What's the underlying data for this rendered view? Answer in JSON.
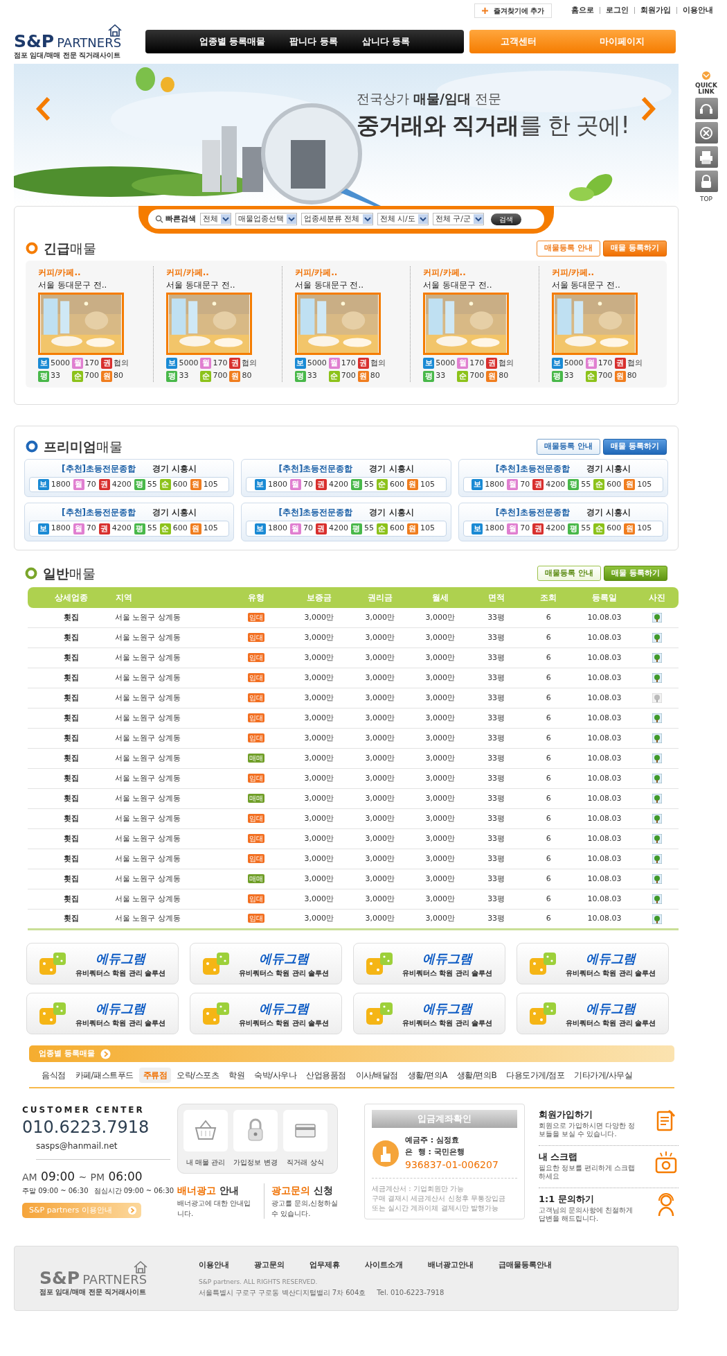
{
  "top_links": {
    "bookmark": "즐겨찾기에 추가",
    "links": [
      "홈으로",
      "로그인",
      "회원가입",
      "이용안내"
    ]
  },
  "logo": {
    "brand": "S&P",
    "brand2": "PARTNERS",
    "tagline": "점포 임대/매매 전문 직거래사이트"
  },
  "nav": {
    "main": [
      "업종별 등록매물",
      "팝니다 등록",
      "삽니다 등록"
    ],
    "side": [
      "고객센터",
      "마이페이지"
    ]
  },
  "banner": {
    "line1": "전국상가 **매물/임대** 전문",
    "line2": "**중거래와 직거래**를 한 곳에!"
  },
  "quick_link": {
    "title": "QUICK LINK",
    "top": "TOP"
  },
  "search": {
    "label": "빠른검색",
    "selects": [
      "전체",
      "매물업종선택",
      "업종세분류 전체",
      "전체 시/도",
      "전체 구/군"
    ],
    "button": "검색"
  },
  "urgent": {
    "title": "**긴급**매물",
    "buttons": [
      "매물등록 안내",
      "매물 등록하기"
    ],
    "items": [
      {
        "category": "커피/카페..",
        "location": "서울 동대문구 전..",
        "kind": "picture",
        "stats": [
          {
            "label": "보",
            "value": "5000",
            "color": "#1a8ad4"
          },
          {
            "label": "월",
            "value": "170",
            "color": "#e07fd0"
          },
          {
            "label": "권",
            "value": "협의",
            "color": "#d8302e"
          },
          {
            "label": "평",
            "value": "33",
            "color": "#49b84a"
          },
          {
            "label": "순",
            "value": "700",
            "color": "#8cc21a"
          },
          {
            "label": "원",
            "value": "80",
            "color": "#f07d1e"
          }
        ]
      },
      {
        "category": "커피/카페..",
        "location": "서울 동대문구 전..",
        "kind": "picture",
        "stats": [
          {
            "label": "보",
            "value": "5000",
            "color": "#1a8ad4"
          },
          {
            "label": "월",
            "value": "170",
            "color": "#e07fd0"
          },
          {
            "label": "권",
            "value": "협의",
            "color": "#d8302e"
          },
          {
            "label": "평",
            "value": "33",
            "color": "#49b84a"
          },
          {
            "label": "순",
            "value": "700",
            "color": "#8cc21a"
          },
          {
            "label": "원",
            "value": "80",
            "color": "#f07d1e"
          }
        ]
      },
      {
        "category": "커피/카페..",
        "location": "서울 동대문구 전..",
        "kind": "picture",
        "stats": [
          {
            "label": "보",
            "value": "5000",
            "color": "#1a8ad4"
          },
          {
            "label": "월",
            "value": "170",
            "color": "#e07fd0"
          },
          {
            "label": "권",
            "value": "협의",
            "color": "#d8302e"
          },
          {
            "label": "평",
            "value": "33",
            "color": "#49b84a"
          },
          {
            "label": "순",
            "value": "700",
            "color": "#8cc21a"
          },
          {
            "label": "원",
            "value": "80",
            "color": "#f07d1e"
          }
        ]
      },
      {
        "category": "커피/카페..",
        "location": "서울 동대문구 전..",
        "kind": "picture",
        "stats": [
          {
            "label": "보",
            "value": "5000",
            "color": "#1a8ad4"
          },
          {
            "label": "월",
            "value": "170",
            "color": "#e07fd0"
          },
          {
            "label": "권",
            "value": "협의",
            "color": "#d8302e"
          },
          {
            "label": "평",
            "value": "33",
            "color": "#49b84a"
          },
          {
            "label": "순",
            "value": "700",
            "color": "#8cc21a"
          },
          {
            "label": "원",
            "value": "80",
            "color": "#f07d1e"
          }
        ]
      },
      {
        "category": "커피/카페..",
        "location": "서울 동대문구 전..",
        "kind": "picture",
        "stats": [
          {
            "label": "보",
            "value": "5000",
            "color": "#1a8ad4"
          },
          {
            "label": "월",
            "value": "170",
            "color": "#e07fd0"
          },
          {
            "label": "권",
            "value": "협의",
            "color": "#d8302e"
          },
          {
            "label": "평",
            "value": "33",
            "color": "#49b84a"
          },
          {
            "label": "순",
            "value": "700",
            "color": "#8cc21a"
          },
          {
            "label": "원",
            "value": "80",
            "color": "#f07d1e"
          }
        ]
      }
    ]
  },
  "premium": {
    "title": "**프리미엄**매물",
    "buttons": [
      "매물등록 안내",
      "매물 등록하기"
    ],
    "items": [
      {
        "tag": "[추천]초등전문종합",
        "location": "경기 시흥시",
        "stats": [
          {
            "label": "보",
            "value": "1800",
            "color": "#1a8ad4"
          },
          {
            "label": "월",
            "value": "70",
            "color": "#e07fd0"
          },
          {
            "label": "권",
            "value": "4200",
            "color": "#d8302e"
          },
          {
            "label": "평",
            "value": "55",
            "color": "#49b84a"
          },
          {
            "label": "순",
            "value": "600",
            "color": "#8cc21a"
          },
          {
            "label": "원",
            "value": "105",
            "color": "#f07d1e"
          }
        ]
      },
      {
        "tag": "[추천]초등전문종합",
        "location": "경기 시흥시",
        "stats": [
          {
            "label": "보",
            "value": "1800",
            "color": "#1a8ad4"
          },
          {
            "label": "월",
            "value": "70",
            "color": "#e07fd0"
          },
          {
            "label": "권",
            "value": "4200",
            "color": "#d8302e"
          },
          {
            "label": "평",
            "value": "55",
            "color": "#49b84a"
          },
          {
            "label": "순",
            "value": "600",
            "color": "#8cc21a"
          },
          {
            "label": "원",
            "value": "105",
            "color": "#f07d1e"
          }
        ]
      },
      {
        "tag": "[추천]초등전문종합",
        "location": "경기 시흥시",
        "stats": [
          {
            "label": "보",
            "value": "1800",
            "color": "#1a8ad4"
          },
          {
            "label": "월",
            "value": "70",
            "color": "#e07fd0"
          },
          {
            "label": "권",
            "value": "4200",
            "color": "#d8302e"
          },
          {
            "label": "평",
            "value": "55",
            "color": "#49b84a"
          },
          {
            "label": "순",
            "value": "600",
            "color": "#8cc21a"
          },
          {
            "label": "원",
            "value": "105",
            "color": "#f07d1e"
          }
        ]
      },
      {
        "tag": "[추천]초등전문종합",
        "location": "경기 시흥시",
        "stats": [
          {
            "label": "보",
            "value": "1800",
            "color": "#1a8ad4"
          },
          {
            "label": "월",
            "value": "70",
            "color": "#e07fd0"
          },
          {
            "label": "권",
            "value": "4200",
            "color": "#d8302e"
          },
          {
            "label": "평",
            "value": "55",
            "color": "#49b84a"
          },
          {
            "label": "순",
            "value": "600",
            "color": "#8cc21a"
          },
          {
            "label": "원",
            "value": "105",
            "color": "#f07d1e"
          }
        ]
      },
      {
        "tag": "[추천]초등전문종합",
        "location": "경기 시흥시",
        "stats": [
          {
            "label": "보",
            "value": "1800",
            "color": "#1a8ad4"
          },
          {
            "label": "월",
            "value": "70",
            "color": "#e07fd0"
          },
          {
            "label": "권",
            "value": "4200",
            "color": "#d8302e"
          },
          {
            "label": "평",
            "value": "55",
            "color": "#49b84a"
          },
          {
            "label": "순",
            "value": "600",
            "color": "#8cc21a"
          },
          {
            "label": "원",
            "value": "105",
            "color": "#f07d1e"
          }
        ]
      },
      {
        "tag": "[추천]초등전문종합",
        "location": "경기 시흥시",
        "stats": [
          {
            "label": "보",
            "value": "1800",
            "color": "#1a8ad4"
          },
          {
            "label": "월",
            "value": "70",
            "color": "#e07fd0"
          },
          {
            "label": "권",
            "value": "4200",
            "color": "#d8302e"
          },
          {
            "label": "평",
            "value": "55",
            "color": "#49b84a"
          },
          {
            "label": "순",
            "value": "600",
            "color": "#8cc21a"
          },
          {
            "label": "원",
            "value": "105",
            "color": "#f07d1e"
          }
        ]
      }
    ]
  },
  "general": {
    "title": "**일반**매물",
    "buttons": [
      "매물등록 안내",
      "매물 등록하기"
    ],
    "columns": [
      "상세업종",
      "지역",
      "유형",
      "보증금",
      "권리금",
      "월세",
      "면적",
      "조회",
      "등록일",
      "사진"
    ],
    "rows": [
      {
        "category": "횟집",
        "region": "서울 노원구 상계동",
        "type": {
          "label": "임대",
          "color": "#f26f21"
        },
        "deposit": "3,000만",
        "premium": "3,000만",
        "rent": "3,000만",
        "area": "33평",
        "views": "6",
        "date": "10.08.03",
        "photo": true
      },
      {
        "category": "횟집",
        "region": "서울 노원구 상계동",
        "type": {
          "label": "임대",
          "color": "#f26f21"
        },
        "deposit": "3,000만",
        "premium": "3,000만",
        "rent": "3,000만",
        "area": "33평",
        "views": "6",
        "date": "10.08.03",
        "photo": true
      },
      {
        "category": "횟집",
        "region": "서울 노원구 상계동",
        "type": {
          "label": "임대",
          "color": "#f26f21"
        },
        "deposit": "3,000만",
        "premium": "3,000만",
        "rent": "3,000만",
        "area": "33평",
        "views": "6",
        "date": "10.08.03",
        "photo": true
      },
      {
        "category": "횟집",
        "region": "서울 노원구 상계동",
        "type": {
          "label": "임대",
          "color": "#f26f21"
        },
        "deposit": "3,000만",
        "premium": "3,000만",
        "rent": "3,000만",
        "area": "33평",
        "views": "6",
        "date": "10.08.03",
        "photo": true
      },
      {
        "category": "횟집",
        "region": "서울 노원구 상계동",
        "type": {
          "label": "임대",
          "color": "#f26f21"
        },
        "deposit": "3,000만",
        "premium": "3,000만",
        "rent": "3,000만",
        "area": "33평",
        "views": "6",
        "date": "10.08.03",
        "photo": false
      },
      {
        "category": "횟집",
        "region": "서울 노원구 상계동",
        "type": {
          "label": "임대",
          "color": "#f26f21"
        },
        "deposit": "3,000만",
        "premium": "3,000만",
        "rent": "3,000만",
        "area": "33평",
        "views": "6",
        "date": "10.08.03",
        "photo": true
      },
      {
        "category": "횟집",
        "region": "서울 노원구 상계동",
        "type": {
          "label": "임대",
          "color": "#f26f21"
        },
        "deposit": "3,000만",
        "premium": "3,000만",
        "rent": "3,000만",
        "area": "33평",
        "views": "6",
        "date": "10.08.03",
        "photo": true
      },
      {
        "category": "횟집",
        "region": "서울 노원구 상계동",
        "type": {
          "label": "매매",
          "color": "#6f9e27"
        },
        "deposit": "3,000만",
        "premium": "3,000만",
        "rent": "3,000만",
        "area": "33평",
        "views": "6",
        "date": "10.08.03",
        "photo": true
      },
      {
        "category": "횟집",
        "region": "서울 노원구 상계동",
        "type": {
          "label": "임대",
          "color": "#f26f21"
        },
        "deposit": "3,000만",
        "premium": "3,000만",
        "rent": "3,000만",
        "area": "33평",
        "views": "6",
        "date": "10.08.03",
        "photo": true
      },
      {
        "category": "횟집",
        "region": "서울 노원구 상계동",
        "type": {
          "label": "매매",
          "color": "#6f9e27"
        },
        "deposit": "3,000만",
        "premium": "3,000만",
        "rent": "3,000만",
        "area": "33평",
        "views": "6",
        "date": "10.08.03",
        "photo": true
      },
      {
        "category": "횟집",
        "region": "서울 노원구 상계동",
        "type": {
          "label": "임대",
          "color": "#f26f21"
        },
        "deposit": "3,000만",
        "premium": "3,000만",
        "rent": "3,000만",
        "area": "33평",
        "views": "6",
        "date": "10.08.03",
        "photo": true
      },
      {
        "category": "횟집",
        "region": "서울 노원구 상계동",
        "type": {
          "label": "임대",
          "color": "#f26f21"
        },
        "deposit": "3,000만",
        "premium": "3,000만",
        "rent": "3,000만",
        "area": "33평",
        "views": "6",
        "date": "10.08.03",
        "photo": true
      },
      {
        "category": "횟집",
        "region": "서울 노원구 상계동",
        "type": {
          "label": "임대",
          "color": "#f26f21"
        },
        "deposit": "3,000만",
        "premium": "3,000만",
        "rent": "3,000만",
        "area": "33평",
        "views": "6",
        "date": "10.08.03",
        "photo": true
      },
      {
        "category": "횟집",
        "region": "서울 노원구 상계동",
        "type": {
          "label": "매매",
          "color": "#6f9e27"
        },
        "deposit": "3,000만",
        "premium": "3,000만",
        "rent": "3,000만",
        "area": "33평",
        "views": "6",
        "date": "10.08.03",
        "photo": true
      },
      {
        "category": "횟집",
        "region": "서울 노원구 상계동",
        "type": {
          "label": "임대",
          "color": "#f26f21"
        },
        "deposit": "3,000만",
        "premium": "3,000만",
        "rent": "3,000만",
        "area": "33평",
        "views": "6",
        "date": "10.08.03",
        "photo": true
      },
      {
        "category": "횟집",
        "region": "서울 노원구 상계동",
        "type": {
          "label": "임대",
          "color": "#f26f21"
        },
        "deposit": "3,000만",
        "premium": "3,000만",
        "rent": "3,000만",
        "area": "33평",
        "views": "6",
        "date": "10.08.03",
        "photo": true
      }
    ]
  },
  "ads": [
    {
      "title": "에듀그램",
      "subtitle": "유비쿼터스 학원 관리 솔루션"
    },
    {
      "title": "에듀그램",
      "subtitle": "유비쿼터스 학원 관리 솔루션"
    },
    {
      "title": "에듀그램",
      "subtitle": "유비쿼터스 학원 관리 솔루션"
    },
    {
      "title": "에듀그램",
      "subtitle": "유비쿼터스 학원 관리 솔루션"
    },
    {
      "title": "에듀그램",
      "subtitle": "유비쿼터스 학원 관리 솔루션"
    },
    {
      "title": "에듀그램",
      "subtitle": "유비쿼터스 학원 관리 솔루션"
    },
    {
      "title": "에듀그램",
      "subtitle": "유비쿼터스 학원 관리 솔루션"
    },
    {
      "title": "에듀그램",
      "subtitle": "유비쿼터스 학원 관리 솔루션"
    }
  ],
  "categories": {
    "title": "업종별 등록매물",
    "items": [
      {
        "label": "음식점",
        "selected": false
      },
      {
        "label": "카페/패스트푸드",
        "selected": false
      },
      {
        "label": "주류점",
        "selected": true
      },
      {
        "label": "오락/스포츠",
        "selected": false
      },
      {
        "label": "학원",
        "selected": false
      },
      {
        "label": "숙박/사우나",
        "selected": false
      },
      {
        "label": "산업용품점",
        "selected": false
      },
      {
        "label": "이사/배달점",
        "selected": false
      },
      {
        "label": "생활/편의A",
        "selected": false
      },
      {
        "label": "생활/편의B",
        "selected": false
      },
      {
        "label": "다용도가게/점포",
        "selected": false
      },
      {
        "label": "기타가게/사무실",
        "selected": false
      }
    ]
  },
  "customer_center": {
    "title": "CUSTOMER CENTER",
    "phone": "010.6223.7918",
    "email": "sasps@hanmail.net",
    "hours": {
      "open_label": "AM",
      "open": "09:00",
      "sep": "~",
      "close_label": "PM",
      "close": "06:00"
    },
    "weekend": "주말 09:00 ~ 06:30",
    "lunch": "점심시간 09:00 ~ 06:30",
    "guide_button": "S&P partners 이용안내"
  },
  "quick_menu": [
    "내 매물 관리",
    "가입정보 변경",
    "직거래 상식"
  ],
  "ad_info": [
    {
      "title": "**배너광고** 안내",
      "text": "배너광고에 대한 안내입니다."
    },
    {
      "title": "**광고문의** 신청",
      "text": "광고를 문의,신청하실 수 있습니다."
    }
  ],
  "account": {
    "title": "입금계좌확인",
    "holder": "예금주 : 심정효",
    "bank": "은  행 : 국민은행",
    "number": "936837-01-006207",
    "notes": [
      "세금계산서 : 기업회원만 가능",
      "구매 결재시 세금계산서 신청후 무통장입금",
      "또는 실시간 계좌이체 결제시만 발행가능"
    ]
  },
  "member_links": [
    {
      "kind": "join",
      "title": "회원가입하기",
      "text": "회원으로 가입하시면 다양한 정보들을 보실 수 있습니다."
    },
    {
      "kind": "scrap",
      "title": "내 스크랩",
      "text": "필요한 정보를 편리하게 스크랩하세요"
    },
    {
      "kind": "inquiry",
      "title": "1:1 문의하기",
      "text": "고객님의 문의사항에 친절하게 답변을 해드립니다."
    }
  ],
  "footer": {
    "logo": {
      "brand": "S&P",
      "brand2": "PARTNERS",
      "tagline": "점포 임대/매매 전문 직거래사이트"
    },
    "links": [
      "이용안내",
      "광고문의",
      "업무제휴",
      "사이트소개",
      "배너광고안내",
      "급매물등록안내"
    ],
    "copyright": "S&P partners. ALL RIGHTS RESERVED.",
    "address": "서울특별시 구로구 구로동 벽산디지털밸리 7차 604호",
    "tel": "Tel. 010-6223-7918"
  }
}
